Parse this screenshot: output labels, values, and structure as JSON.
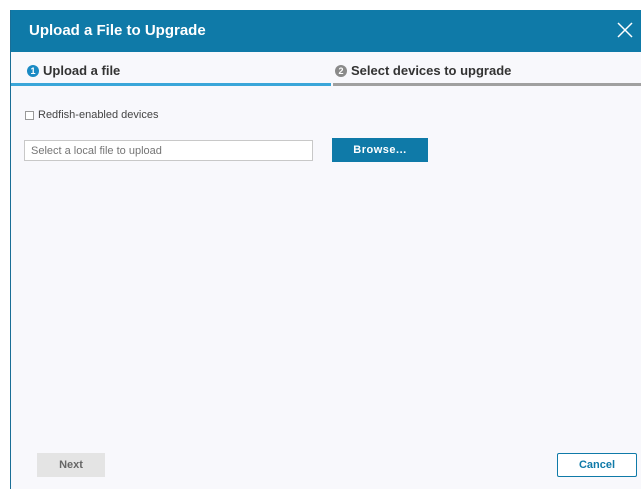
{
  "dialog": {
    "title": "Upload a File to Upgrade",
    "close_icon": "close-icon"
  },
  "steps": [
    {
      "number": "1",
      "label": "Upload a file",
      "active": true
    },
    {
      "number": "2",
      "label": "Select devices to upgrade",
      "active": false
    }
  ],
  "form": {
    "redfish_checkbox_label": "Redfish-enabled devices",
    "redfish_checked": false,
    "file_placeholder": "Select a local file to upload",
    "browse_label": "Browse..."
  },
  "footer": {
    "next_label": "Next",
    "cancel_label": "Cancel"
  },
  "colors": {
    "title_bar": "#0f7aa8",
    "active_step": "#3aa6d9",
    "inactive_step": "#a0a0a0"
  }
}
